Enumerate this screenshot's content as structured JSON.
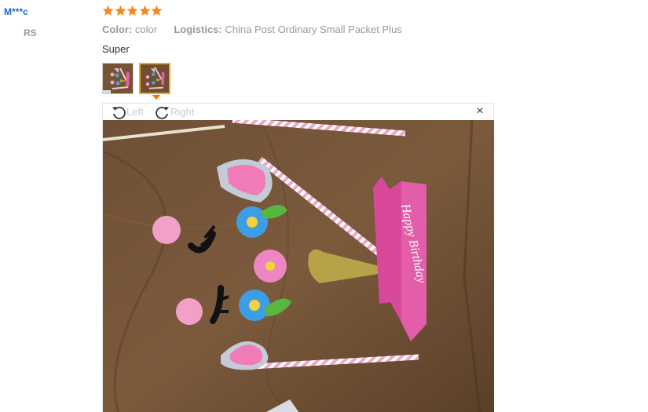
{
  "reviewer": {
    "name": "M***c",
    "country": "RS"
  },
  "rating": {
    "stars": 5,
    "max": 5,
    "color": "#f5891f"
  },
  "attributes": {
    "color_label": "Color:",
    "color_value": "color",
    "logistics_label": "Logistics:",
    "logistics_value": "China Post Ordinary Small Packet Plus"
  },
  "review": {
    "text": "Super"
  },
  "thumbnails": {
    "count": 2,
    "selected_index": 1
  },
  "viewer": {
    "rotate_left_label": "Left",
    "rotate_right_label": "Right",
    "close_icon": "×",
    "banner_text": "Happy Birthday"
  },
  "colors": {
    "name_link": "#1b6ac9",
    "muted": "#999999",
    "active_thumb_border": "#f5a623",
    "pointer": "#ff6a00"
  }
}
